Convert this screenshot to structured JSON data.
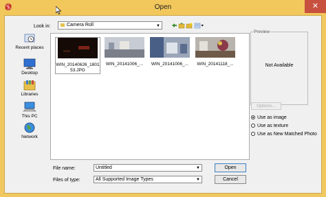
{
  "window": {
    "title": "Open",
    "close_glyph": "✕"
  },
  "lookin": {
    "label": "Look in:",
    "value": "Camera Roll"
  },
  "places": [
    {
      "label": "Recent places",
      "icon": "recent-places-icon"
    },
    {
      "label": "Desktop",
      "icon": "desktop-icon"
    },
    {
      "label": "Libraries",
      "icon": "libraries-icon"
    },
    {
      "label": "This PC",
      "icon": "this-pc-icon"
    },
    {
      "label": "Network",
      "icon": "network-icon"
    }
  ],
  "files": [
    {
      "name": "WIN_20140626_180153.JPG"
    },
    {
      "name": "WIN_20141006_..."
    },
    {
      "name": "WIN_20141006_..."
    },
    {
      "name": "WIN_20141118_..."
    }
  ],
  "preview": {
    "label": "Preview",
    "status": "Not Available"
  },
  "options_label": "Options...",
  "radios": [
    {
      "label": "Use as image",
      "selected": true
    },
    {
      "label": "Use as texture",
      "selected": false
    },
    {
      "label": "Use as New Matched Photo",
      "selected": false
    }
  ],
  "filename": {
    "label": "File name:",
    "value": "Untitled"
  },
  "filetype": {
    "label": "Files of type:",
    "value": "All Supported Image Types"
  },
  "buttons": {
    "open": "Open",
    "cancel": "Cancel"
  },
  "colors": {
    "titlebar": "#f2c75c",
    "close": "#c7503f",
    "focus": "#3b7fc4"
  }
}
